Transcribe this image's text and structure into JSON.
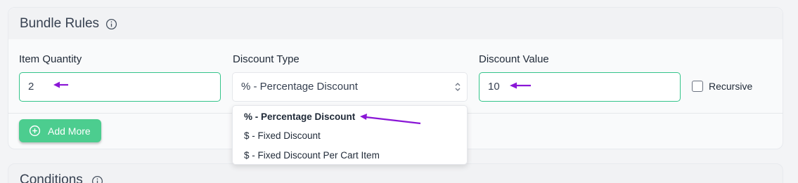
{
  "bundle_rules": {
    "title": "Bundle Rules",
    "item_quantity": {
      "label": "Item Quantity",
      "value": "2"
    },
    "discount_type": {
      "label": "Discount Type",
      "value": "% - Percentage Discount",
      "options": [
        "% - Percentage Discount",
        "$ - Fixed Discount",
        "$ - Fixed Discount Per Cart Item"
      ]
    },
    "discount_value": {
      "label": "Discount Value",
      "value": "10"
    },
    "recursive_label": "Recursive",
    "add_more_label": "Add More"
  },
  "conditions": {
    "title": "Conditions"
  },
  "colors": {
    "accent": "#4ccd8f",
    "focus_border": "#34c48a",
    "annotation": "#8a16d6"
  },
  "icons": [
    "info-icon",
    "chevron-updown-icon",
    "plus-circle-icon",
    "annotation-arrow"
  ]
}
